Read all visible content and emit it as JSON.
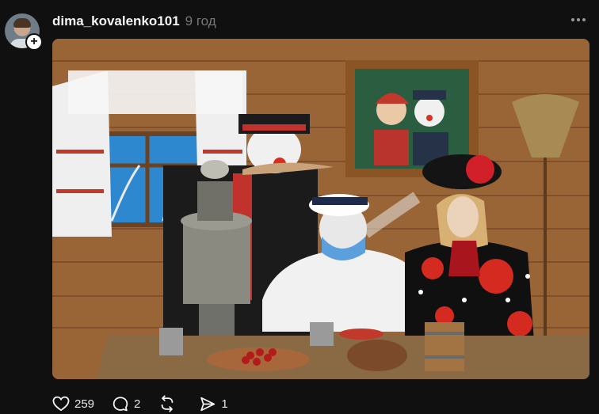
{
  "post": {
    "author": {
      "username": "dima_kovalenko101",
      "avatar_icon": "user-avatar",
      "follow_icon": "plus-icon"
    },
    "timestamp": "9 год",
    "more_icon": "more-horizontal-icon",
    "image_alt": "",
    "actions": {
      "like": {
        "icon": "heart-icon",
        "count": "259"
      },
      "comment": {
        "icon": "comment-icon",
        "count": "2"
      },
      "repost": {
        "icon": "repost-icon",
        "count": ""
      },
      "share": {
        "icon": "send-icon",
        "count": "1"
      }
    }
  },
  "colors": {
    "background": "#101010",
    "text_primary": "#f3f5f7",
    "text_secondary": "#777777"
  }
}
